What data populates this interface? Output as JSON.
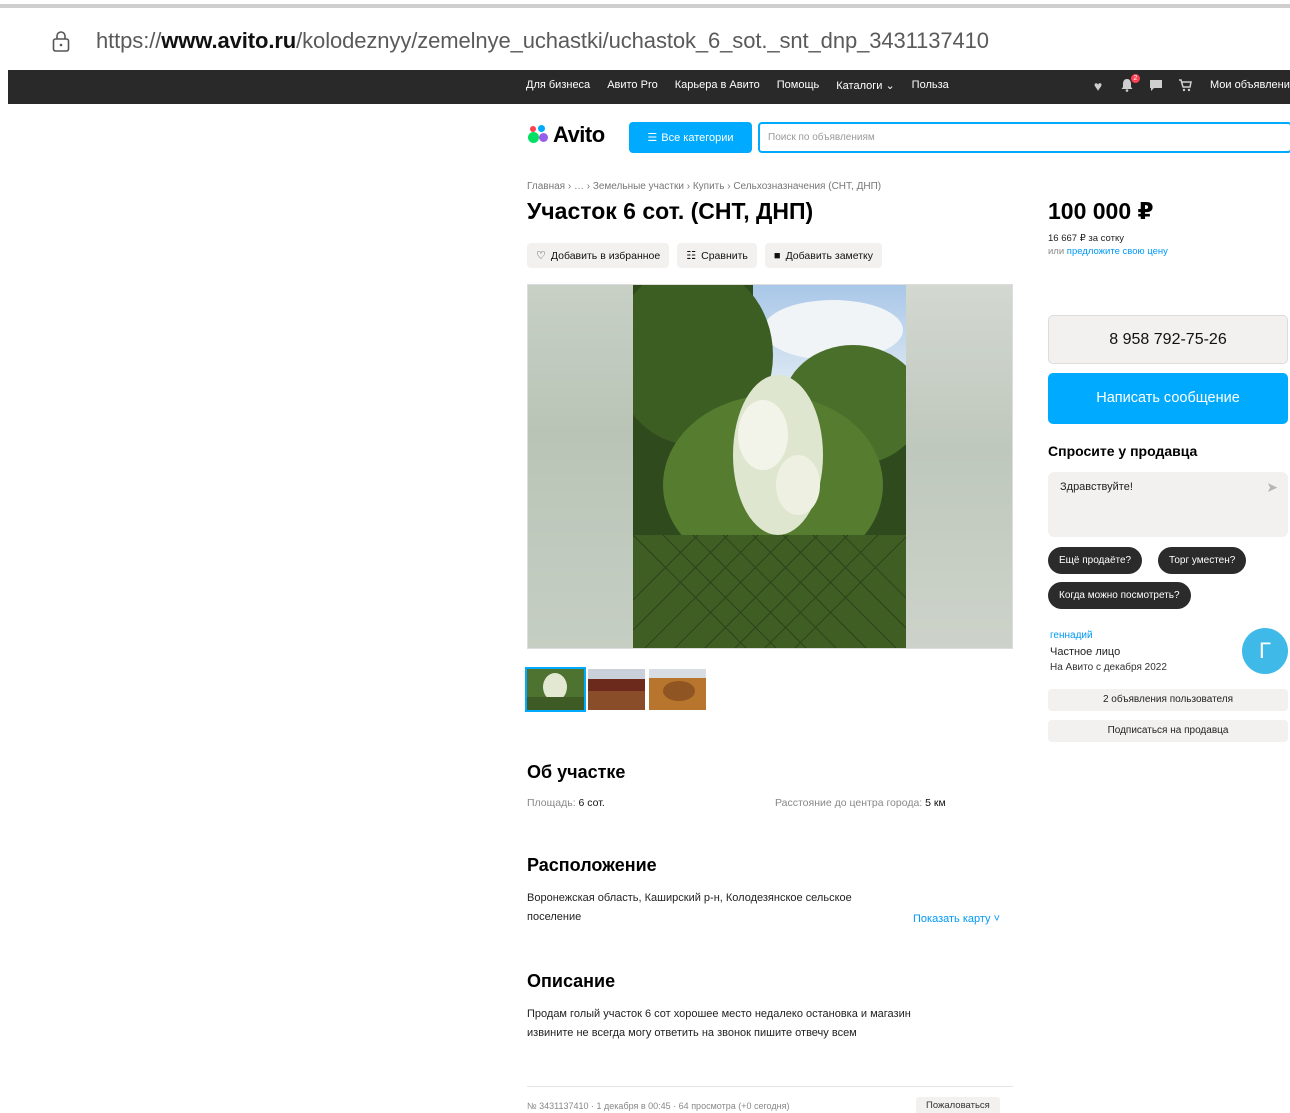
{
  "browser": {
    "url_prefix": "https://",
    "url_host": "www.avito.ru",
    "url_path": "/kolodeznyy/zemelnye_uchastki/uchastok_6_sot._snt_dnp_3431137410"
  },
  "topnav": {
    "links": [
      "Для бизнеса",
      "Авито Pro",
      "Карьера в Авито",
      "Помощь",
      "Каталоги ⌄",
      "Польза"
    ],
    "notif_badge": "2",
    "my_ads": "Мои объявления",
    "icons": [
      "heart-icon",
      "bell-icon",
      "chat-icon",
      "cart-icon"
    ]
  },
  "header": {
    "logo": "Avito",
    "all_categories": "Все категории",
    "search_placeholder": "Поиск по объявлениям"
  },
  "breadcrumbs": "Главная › … › Земельные участки › Купить › Сельхозназначения (СНТ, ДНП)",
  "title": "Участок 6 сот. (СНТ, ДНП)",
  "actions": {
    "favorite": "Добавить в избранное",
    "compare": "Сравнить",
    "note": "Добавить заметку"
  },
  "about": {
    "heading": "Об участке",
    "area_label": "Площадь: ",
    "area_value": "6 сот.",
    "distance_label": "Расстояние до центра города: ",
    "distance_value": "5 км"
  },
  "location": {
    "heading": "Расположение",
    "address_line1": "Воронежская область, Каширский р-н, Колодезянское сельское",
    "address_line2": "поселение",
    "show_map": "Показать карту ˅"
  },
  "description": {
    "heading": "Описание",
    "line1": "Продам голый участок 6 сот хорошее место недалеко остановка и магазин",
    "line2": "извините не всегда могу ответить на звонок пишите отвечу всем"
  },
  "meta": "№ 3431137410 · 1 декабря в 00:45 · 64 просмотра (+0 сегодня)",
  "complain": "Пожаловаться",
  "price": {
    "value": "100 000 ₽",
    "per_unit": "16 667 ₽ за сотку",
    "offer_prefix": "или ",
    "offer_link": "предложите свою цену"
  },
  "contact": {
    "phone": "8 958 792-75-26",
    "write": "Написать сообщение",
    "ask_heading": "Спросите у продавца",
    "message_default": "Здравствуйте!",
    "chips": [
      "Ещё продаёте?",
      "Торг уместен?",
      "Когда можно посмотреть?"
    ]
  },
  "seller": {
    "name": "геннадий",
    "type": "Частное лицо",
    "since": "На Авито с декабря 2022",
    "avatar_letter": "Г",
    "ads_button": "2 объявления пользователя",
    "subscribe_button": "Подписаться на продавца"
  },
  "colors": {
    "accent": "#00aaff",
    "link": "#0099f7",
    "dark_nav": "#292929"
  }
}
